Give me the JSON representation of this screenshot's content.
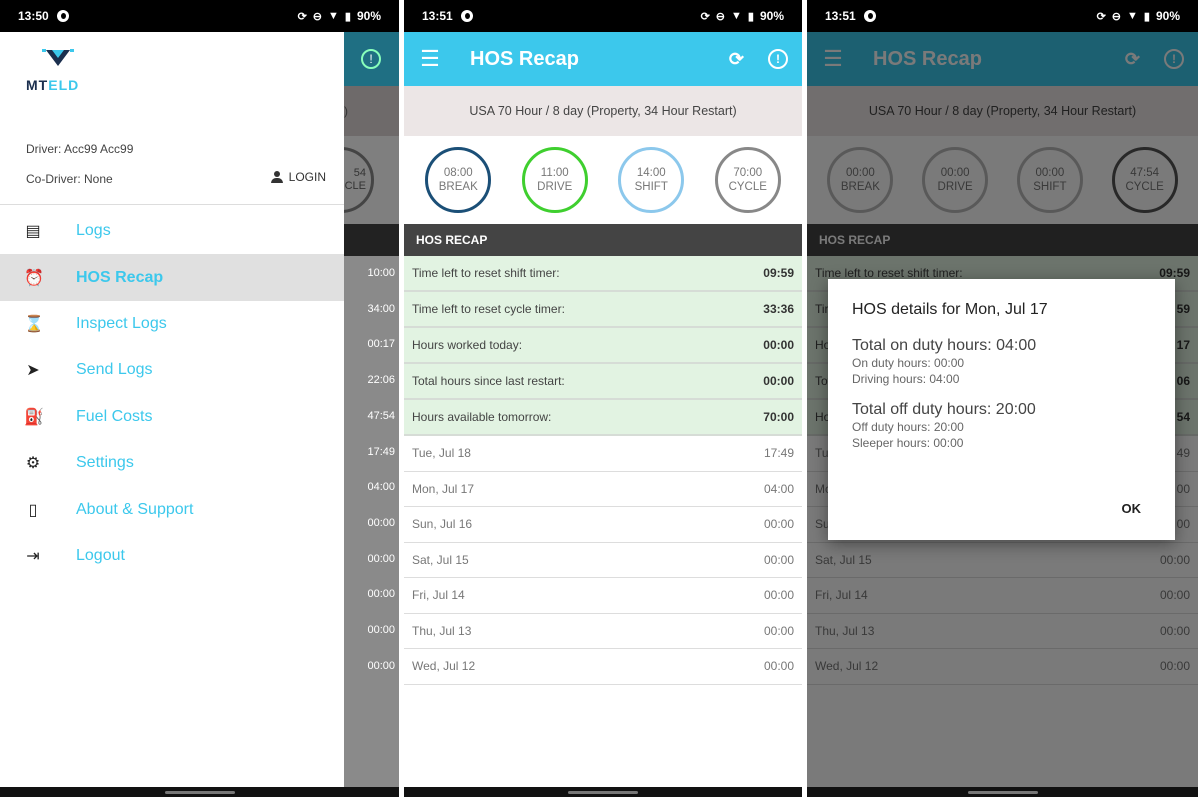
{
  "status": {
    "p1_time": "13:50",
    "p2_time": "13:51",
    "p3_time": "13:51",
    "battery": "90%"
  },
  "app": {
    "title": "HOS Recap",
    "ruleset": "USA 70 Hour / 8 day (Property, 34 Hour Restart)",
    "section": "HOS RECAP"
  },
  "timers": {
    "p2": [
      {
        "value": "08:00",
        "label": "BREAK"
      },
      {
        "value": "11:00",
        "label": "DRIVE"
      },
      {
        "value": "14:00",
        "label": "SHIFT"
      },
      {
        "value": "70:00",
        "label": "CYCLE"
      }
    ],
    "p3": [
      {
        "value": "00:00",
        "label": "BREAK"
      },
      {
        "value": "00:00",
        "label": "DRIVE"
      },
      {
        "value": "00:00",
        "label": "SHIFT"
      },
      {
        "value": "47:54",
        "label": "CYCLE"
      }
    ]
  },
  "summary": {
    "p2": [
      {
        "label": "Time left to reset shift timer:",
        "value": "09:59"
      },
      {
        "label": "Time left to reset cycle timer:",
        "value": "33:36"
      },
      {
        "label": "Hours worked today:",
        "value": "00:00"
      },
      {
        "label": "Total hours since last restart:",
        "value": "00:00"
      },
      {
        "label": "Hours available tomorrow:",
        "value": "70:00"
      }
    ],
    "p3": [
      {
        "label": "Time left to reset shift timer:",
        "value": "09:59"
      },
      {
        "label": "Tir",
        "value": "59"
      },
      {
        "label": "Ho",
        "value": "17"
      },
      {
        "label": "Tot",
        "value": "06"
      },
      {
        "label": "Ho",
        "value": "54"
      }
    ]
  },
  "days": {
    "p2": [
      {
        "day": "Tue, Jul 18",
        "hours": "17:49"
      },
      {
        "day": "Mon, Jul 17",
        "hours": "04:00"
      },
      {
        "day": "Sun, Jul 16",
        "hours": "00:00"
      },
      {
        "day": "Sat, Jul 15",
        "hours": "00:00"
      },
      {
        "day": "Fri, Jul 14",
        "hours": "00:00"
      },
      {
        "day": "Thu, Jul 13",
        "hours": "00:00"
      },
      {
        "day": "Wed, Jul 12",
        "hours": "00:00"
      }
    ],
    "p3": [
      {
        "day": "Tu",
        "hours": "49"
      },
      {
        "day": "Mc",
        "hours": "00"
      },
      {
        "day": "Su",
        "hours": "00"
      },
      {
        "day": "Sat, Jul 15",
        "hours": "00:00"
      },
      {
        "day": "Fri, Jul 14",
        "hours": "00:00"
      },
      {
        "day": "Thu, Jul 13",
        "hours": "00:00"
      },
      {
        "day": "Wed, Jul 12",
        "hours": "00:00"
      }
    ]
  },
  "drawer": {
    "brand": "MTELD",
    "driver": "Driver: Acc99 Acc99",
    "codriver": "Co-Driver: None",
    "login": "LOGIN",
    "items": [
      {
        "label": "Logs",
        "icon": "list-icon"
      },
      {
        "label": "HOS Recap",
        "icon": "alarm-icon"
      },
      {
        "label": "Inspect Logs",
        "icon": "timer-icon"
      },
      {
        "label": "Send Logs",
        "icon": "send-icon"
      },
      {
        "label": "Fuel Costs",
        "icon": "fuel-icon"
      },
      {
        "label": "Settings",
        "icon": "gear-icon"
      },
      {
        "label": "About & Support",
        "icon": "phone-icon"
      },
      {
        "label": "Logout",
        "icon": "logout-icon"
      }
    ],
    "background_values": [
      "10:00",
      "34:00",
      "00:17",
      "22:06",
      "47:54",
      "17:49",
      "04:00",
      "00:00",
      "00:00",
      "00:00",
      "00:00",
      "00:00"
    ],
    "bg_peek_top": ")",
    "bg_peek_circle_value": "54",
    "bg_peek_circle_label": "CLE"
  },
  "dialog": {
    "title": "HOS details for Mon, Jul 17",
    "on_duty_total": "Total on duty hours: 04:00",
    "on_duty_hours": "On duty hours: 00:00",
    "driving_hours": "Driving hours: 04:00",
    "off_duty_total": "Total off duty hours: 20:00",
    "off_duty_hours": "Off duty hours: 20:00",
    "sleeper_hours": "Sleeper hours: 00:00",
    "ok": "OK"
  }
}
